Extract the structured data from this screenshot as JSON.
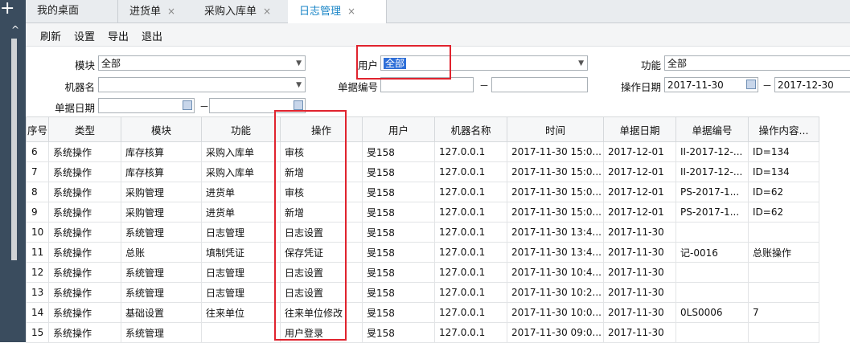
{
  "sidebar": {
    "plus": "+",
    "up": "^"
  },
  "tabs": [
    {
      "label": "我的桌面",
      "closable": false
    },
    {
      "label": "进货单",
      "closable": true
    },
    {
      "label": "采购入库单",
      "closable": true
    },
    {
      "label": "日志管理",
      "closable": true,
      "active": true
    }
  ],
  "tab_close": "×",
  "toolbar": {
    "refresh": "刷新",
    "settings": "设置",
    "export": "导出",
    "exit": "退出"
  },
  "form": {
    "module_label": "模块",
    "module_value": "全部",
    "user_label": "用户",
    "user_value": "全部",
    "function_label": "功能",
    "function_value": "全部",
    "machine_label": "机器名",
    "machine_value": "",
    "docno_label": "单据编号",
    "docno_from": "",
    "docno_to": "",
    "opdate_label": "操作日期",
    "opdate_from": "2017-11-30",
    "opdate_to": "2017-12-30",
    "docdate_label": "单据日期",
    "docdate_from": "",
    "docdate_to": "",
    "dash": "－",
    "dropdown_arrow": "▼"
  },
  "table": {
    "headers": [
      "序号",
      "类型",
      "模块",
      "功能",
      "操作",
      "用户",
      "机器名称",
      "时间",
      "单据日期",
      "单据编号",
      "操作内容..."
    ],
    "rows": [
      [
        "6",
        "系统操作",
        "库存核算",
        "采购入库单",
        "审核",
        "旻158",
        "127.0.0.1",
        "2017-11-30 15:0...",
        "2017-12-01",
        "II-2017-12-...",
        "ID=134"
      ],
      [
        "7",
        "系统操作",
        "库存核算",
        "采购入库单",
        "新增",
        "旻158",
        "127.0.0.1",
        "2017-11-30 15:0...",
        "2017-12-01",
        "II-2017-12-...",
        "ID=134"
      ],
      [
        "8",
        "系统操作",
        "采购管理",
        "进货单",
        "审核",
        "旻158",
        "127.0.0.1",
        "2017-11-30 15:0...",
        "2017-12-01",
        "PS-2017-1...",
        "ID=62"
      ],
      [
        "9",
        "系统操作",
        "采购管理",
        "进货单",
        "新增",
        "旻158",
        "127.0.0.1",
        "2017-11-30 15:0...",
        "2017-12-01",
        "PS-2017-1...",
        "ID=62"
      ],
      [
        "10",
        "系统操作",
        "系统管理",
        "日志管理",
        "日志设置",
        "旻158",
        "127.0.0.1",
        "2017-11-30 13:4...",
        "2017-11-30",
        "",
        ""
      ],
      [
        "11",
        "系统操作",
        "总账",
        "填制凭证",
        "保存凭证",
        "旻158",
        "127.0.0.1",
        "2017-11-30 13:4...",
        "2017-11-30",
        "记-0016",
        "总账操作"
      ],
      [
        "12",
        "系统操作",
        "系统管理",
        "日志管理",
        "日志设置",
        "旻158",
        "127.0.0.1",
        "2017-11-30 10:4...",
        "2017-11-30",
        "",
        ""
      ],
      [
        "13",
        "系统操作",
        "系统管理",
        "日志管理",
        "日志设置",
        "旻158",
        "127.0.0.1",
        "2017-11-30 10:2...",
        "2017-11-30",
        "",
        ""
      ],
      [
        "14",
        "系统操作",
        "基础设置",
        "往来单位",
        "往来单位修改",
        "旻158",
        "127.0.0.1",
        "2017-11-30 10:0...",
        "2017-11-30",
        "0LS0006",
        "7"
      ],
      [
        "15",
        "系统操作",
        "系统管理",
        "",
        "用户登录",
        "旻158",
        "127.0.0.1",
        "2017-11-30 09:0...",
        "2017-11-30",
        "",
        ""
      ]
    ]
  },
  "highlight_color": "#e0232e"
}
